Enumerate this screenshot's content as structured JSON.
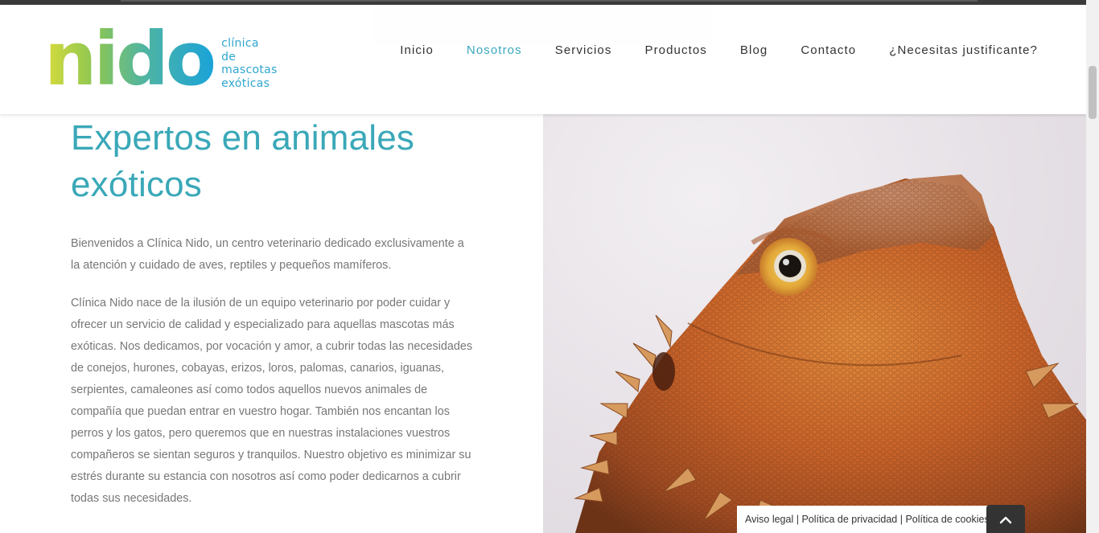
{
  "brand": {
    "name": "nido",
    "tagline": [
      "clínica",
      "de",
      "mascotas",
      "exóticas"
    ]
  },
  "nav": {
    "items": [
      {
        "label": "Inicio",
        "active": false
      },
      {
        "label": "Nosotros",
        "active": true
      },
      {
        "label": "Servicios",
        "active": false
      },
      {
        "label": "Productos",
        "active": false
      },
      {
        "label": "Blog",
        "active": false
      },
      {
        "label": "Contacto",
        "active": false
      },
      {
        "label": "¿Necesitas justificante?",
        "active": false
      }
    ]
  },
  "main": {
    "title": "Expertos en animales exóticos",
    "paragraphs": [
      "Bienvenidos a Clínica Nido, un centro veterinario dedicado exclusivamente a la atención y cuidado de aves, reptiles y pequeños mamíferos.",
      "Clínica Nido nace de la ilusión de un equipo veterinario por poder cuidar y ofrecer un servicio de calidad y especializado para aquellas mascotas más exóticas. Nos dedicamos, por vocación y amor, a cubrir todas las necesidades de conejos, hurones, cobayas, erizos, loros, palomas, canarios, iguanas, serpientes, camaleones así como todos aquellos nuevos animales de compañía que puedan entrar en vuestro hogar. También nos encantan los perros y los gatos, pero queremos que en nuestras instalaciones vuestros compañeros se sientan seguros y tranquilos. Nuestro objetivo es minimizar su estrés durante su estancia con nosotros así como poder dedicarnos a cubrir todas sus necesidades."
    ]
  },
  "footer_links": {
    "aviso": "Aviso legal",
    "sep1": " | ",
    "privacidad": "Política de privacidad",
    "sep2": " | ",
    "cookies": "Política de cookies"
  },
  "icons": {
    "to_top": "chevron-up-icon"
  },
  "colors": {
    "accent": "#3aa8b8",
    "nav_active": "#3aa8c0",
    "body_text": "#777777",
    "logo_gradient": [
      "#d7dc3b",
      "#8cc653",
      "#4fb4a4",
      "#1aa3d8"
    ]
  }
}
